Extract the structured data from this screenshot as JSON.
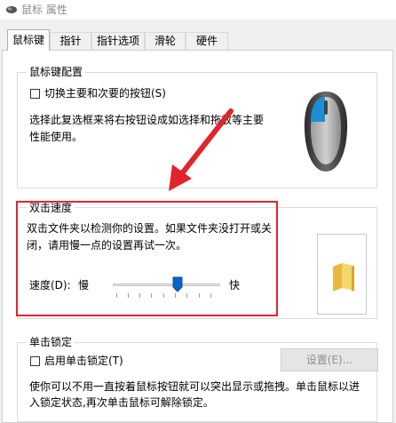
{
  "window": {
    "title": "鼠标 属性"
  },
  "tabs": [
    {
      "label": "鼠标键",
      "active": true
    },
    {
      "label": "指针",
      "active": false
    },
    {
      "label": "指针选项",
      "active": false
    },
    {
      "label": "滑轮",
      "active": false
    },
    {
      "label": "硬件",
      "active": false
    }
  ],
  "button_config": {
    "title": "鼠标键配置",
    "switch_checkbox_label": "切换主要和次要的按钮(S)",
    "switch_checked": false,
    "description_line1": "选择此复选框来将右按钮设成如选择和拖放等主要",
    "description_line2": "性能使用。"
  },
  "double_click": {
    "title": "双击速度",
    "description_line1": "双击文件夹以检测你的设置。如果文件夹没打开或关",
    "description_line2": "闭，请用慢一点的设置再试一次。",
    "speed_label": "速度(D):",
    "slow_label": "慢",
    "fast_label": "快",
    "speed_level": 0.6
  },
  "click_lock": {
    "title": "单击锁定",
    "enable_checkbox_label": "启用单击锁定(T)",
    "enable_checked": false,
    "settings_button_label": "设置(E)...",
    "settings_enabled": false,
    "description_line1": "使你可以不用一直按着鼠标按钮就可以突出显示或拖拽。单击鼠标以进",
    "description_line2": "入锁定状态,再次单击鼠标可解除锁定。"
  },
  "colors": {
    "highlight_red": "#e2242d",
    "mouse_accent_blue": "#1a8fd6"
  },
  "icons": [
    "mouse-title-icon",
    "mouse-illustration",
    "folder-icon",
    "annotation-arrow"
  ]
}
